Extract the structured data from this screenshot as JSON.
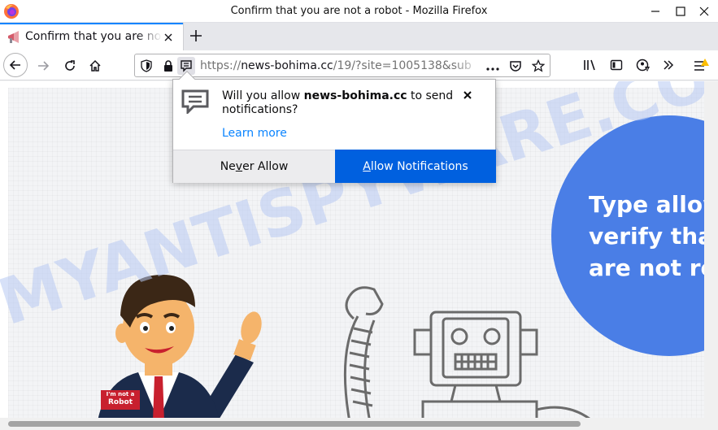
{
  "window": {
    "title": "Confirm that you are not a robot - Mozilla Firefox"
  },
  "tab": {
    "title": "Confirm that you are not a robot"
  },
  "urlbar": {
    "scheme": "https://",
    "host": "news-bohima.cc",
    "path": "/19/?site=1005138&sub"
  },
  "popup": {
    "message_prefix": "Will you allow ",
    "message_site": "news-bohima.cc",
    "message_suffix": " to send notifications?",
    "learn_more": "Learn more",
    "never_prefix": "Ne",
    "never_underlined": "v",
    "never_rest": "er Allow",
    "allow_underlined": "A",
    "allow_rest": "llow Notifications"
  },
  "page": {
    "verify_line1": "Type allow",
    "verify_line2": "verify that",
    "verify_line3": "are not rob",
    "badge_line1": "I'm not a",
    "badge_line2": "Robot",
    "watermark": "MYANTISPYWARE.COM"
  },
  "colors": {
    "accent": "#0060df",
    "circle": "#4a7ee6",
    "link": "#0a84ff",
    "watermark": "#b7c8f3"
  },
  "icons": {
    "back": "arrow-left-icon",
    "forward": "arrow-right-icon",
    "reload": "reload-icon",
    "home": "home-icon",
    "shield": "shield-icon",
    "lock": "lock-icon",
    "notification": "speech-bubble-icon",
    "more": "ellipsis-icon",
    "pocket": "pocket-icon",
    "bookmark": "star-icon",
    "library": "library-icon",
    "sidebar": "sidebar-icon",
    "account": "account-warning-icon",
    "overflow": "double-chevron-icon",
    "menu": "hamburger-menu-icon"
  }
}
